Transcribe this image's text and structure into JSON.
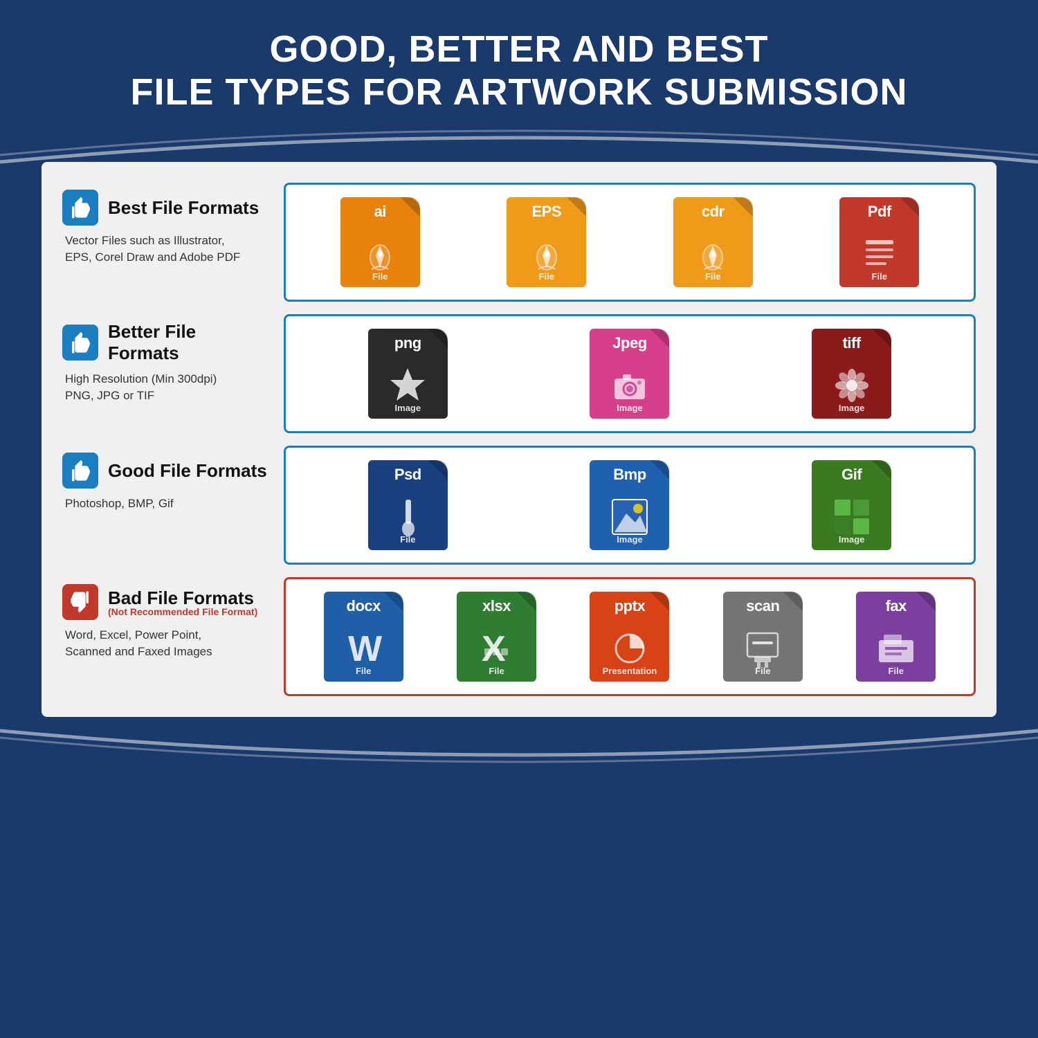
{
  "header": {
    "line1": "GOOD, BETTER AND BEST",
    "line2": "FILE TYPES FOR ARTWORK SUBMISSION"
  },
  "rows": [
    {
      "id": "best",
      "thumb": "up",
      "title": "Best File Formats",
      "subtitle": null,
      "desc": "Vector Files such as Illustrator,\nEPS, Corel Draw and Adobe PDF",
      "borderColor": "#1a7fc1",
      "files": [
        {
          "ext": "ai",
          "color": "orange",
          "label": "File",
          "icon": "pen"
        },
        {
          "ext": "EPS",
          "color": "orange-light",
          "label": "File",
          "icon": "pen"
        },
        {
          "ext": "cdr",
          "color": "orange-light",
          "label": "File",
          "icon": "pen"
        },
        {
          "ext": "Pdf",
          "color": "red",
          "label": "File",
          "icon": "pdf"
        }
      ]
    },
    {
      "id": "better",
      "thumb": "up",
      "title": "Better File Formats",
      "subtitle": null,
      "desc": "High Resolution (Min 300dpi)\nPNG, JPG or TIF",
      "borderColor": "#1a7fc1",
      "files": [
        {
          "ext": "png",
          "color": "black",
          "label": "Image",
          "icon": "star"
        },
        {
          "ext": "Jpeg",
          "color": "pink",
          "label": "Image",
          "icon": "camera"
        },
        {
          "ext": "tiff",
          "color": "dark-red",
          "label": "Image",
          "icon": "flower"
        }
      ]
    },
    {
      "id": "good",
      "thumb": "up",
      "title": "Good File Formats",
      "subtitle": null,
      "desc": "Photoshop, BMP, Gif",
      "borderColor": "#1a7fc1",
      "files": [
        {
          "ext": "Psd",
          "color": "blue-dark",
          "label": "File",
          "icon": "brush"
        },
        {
          "ext": "Bmp",
          "color": "blue-med",
          "label": "Image",
          "icon": "mountain"
        },
        {
          "ext": "Gif",
          "color": "green",
          "label": "Image",
          "icon": "grid"
        }
      ]
    },
    {
      "id": "bad",
      "thumb": "down",
      "title": "Bad File Formats",
      "subtitle": "(Not Recommended File Format)",
      "desc": "Word, Excel, Power Point,\nScanned and Faxed Images",
      "borderColor": "#c0392b",
      "files": [
        {
          "ext": "docx",
          "color": "blue-word",
          "label": "File",
          "icon": "word"
        },
        {
          "ext": "xlsx",
          "color": "green-excel",
          "label": "File",
          "icon": "excel"
        },
        {
          "ext": "pptx",
          "color": "orange-ppt",
          "label": "Presentation",
          "icon": "ppt"
        },
        {
          "ext": "scan",
          "color": "gray",
          "label": "File",
          "icon": "scan"
        },
        {
          "ext": "fax",
          "color": "purple",
          "label": "File",
          "icon": "fax"
        }
      ]
    }
  ]
}
